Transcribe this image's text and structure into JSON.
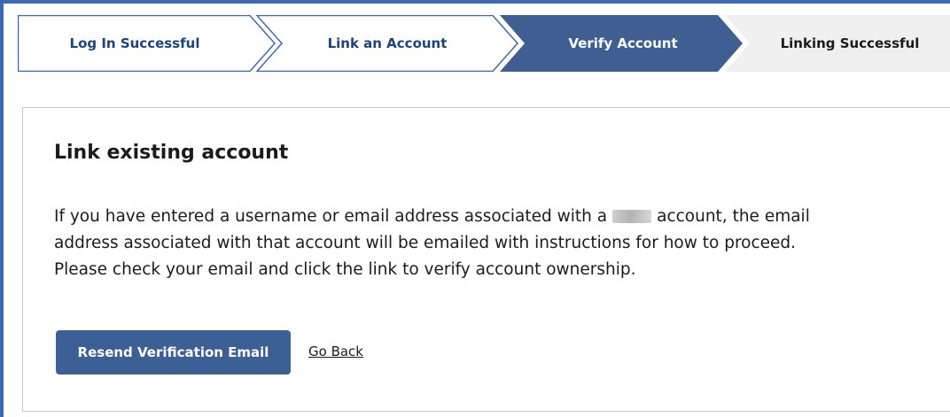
{
  "colors": {
    "frame_border": "#3f68b3",
    "step_text": "#1a4480",
    "step_active_bg": "#3f5f93",
    "step_active_text": "#ffffff",
    "step_future_bg": "#f0f0f0",
    "step_future_text": "#1b1b1b",
    "primary_button": "#3c5f95"
  },
  "stepper": {
    "steps": [
      {
        "label": "Log In Successful",
        "state": "complete"
      },
      {
        "label": "Link an Account",
        "state": "complete"
      },
      {
        "label": "Verify Account",
        "state": "active"
      },
      {
        "label": "Linking Successful",
        "state": "upcoming"
      }
    ]
  },
  "card": {
    "title": "Link existing account",
    "body_part1": "If you have entered a username or email address associated with a",
    "body_part2": "account, the email address associated with that account will be emailed with instructions for how to proceed. Please check your email and click the link to verify account ownership.",
    "resend_label": "Resend Verification Email",
    "back_label": "Go Back"
  }
}
